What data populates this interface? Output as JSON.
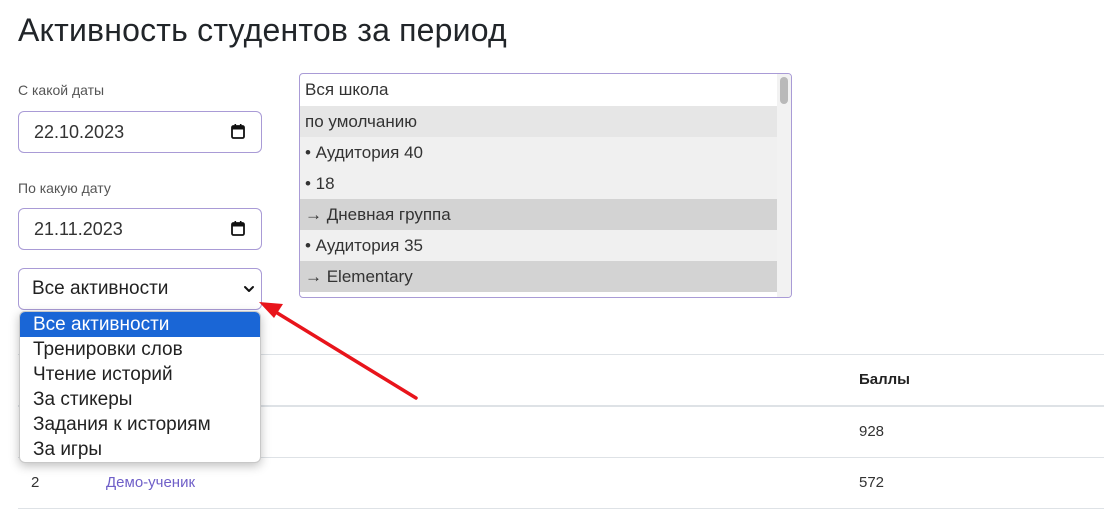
{
  "page": {
    "title": "Активность студентов за период"
  },
  "filters": {
    "from_label": "С какой даты",
    "from_value": "22.10.2023",
    "to_label": "По какую дату",
    "to_value": "21.11.2023",
    "activity_select": {
      "selected": "Все активности",
      "options": [
        "Все активности",
        "Тренировки слов",
        "Чтение историй",
        "За стикеры",
        "Задания к историям",
        "За игры"
      ]
    }
  },
  "group_list": {
    "items": [
      "Вся школа",
      "по умолчанию",
      "• Аудитория 40",
      "• 18",
      "→ Дневная группа",
      "• Аудитория 35",
      "→ Elementary"
    ]
  },
  "table": {
    "headers": {
      "points": "Баллы"
    },
    "rows": [
      {
        "num": "",
        "name": "",
        "points": "928"
      },
      {
        "num": "2",
        "name": "Демо-ученик",
        "points": "572"
      }
    ]
  },
  "colors": {
    "accent": "#6f5fc8",
    "selected_option": "#1a66d6",
    "annotation_arrow": "#e8141b"
  }
}
